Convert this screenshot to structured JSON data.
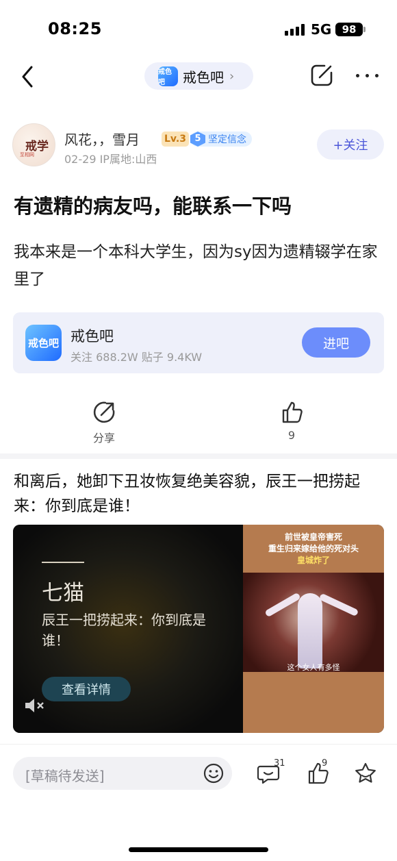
{
  "status_bar": {
    "time": "08:25",
    "network": "5G",
    "battery": "98"
  },
  "nav": {
    "forum_name": "戒色吧",
    "forum_logo_text": "戒色吧"
  },
  "author": {
    "avatar_text": "戒学",
    "avatar_sub": "至相网",
    "name": "风花，，雪月",
    "level": "Lv.3",
    "badge_num": "5",
    "badge_label": "坚定信念",
    "meta": "02-29   IP属地:山西",
    "follow_label": "+关注"
  },
  "post": {
    "title": "有遗精的病友吗，能联系一下吗",
    "body": "我本来是一个本科大学生，因为sy因为遗精辍学在家里了"
  },
  "forum_card": {
    "logo_text": "戒色吧",
    "name": "戒色吧",
    "stats": "关注 688.2W   贴子 9.4KW",
    "enter_label": "进吧"
  },
  "actions": {
    "share_label": "分享",
    "like_count": "9"
  },
  "ad": {
    "title": "和离后，她卸下丑妆恢复绝美容貌，辰王一把捞起来：你到底是谁！",
    "brand": "七猫",
    "desc": "辰王一把捞起来：你到底是谁！",
    "detail_label": "查看详情",
    "right_caption_1": "前世被皇帝害死",
    "right_caption_2": "重生归来嫁给他的死对头",
    "right_caption_3": "皇城炸了",
    "right_sub": "这个女人有多怪"
  },
  "bottom_bar": {
    "draft_placeholder": "[草稿待发送]",
    "comment_count": "31",
    "like_count": "9"
  },
  "colors": {
    "accent": "#6c8dfb",
    "pill_bg": "#eef0fb",
    "follow_text": "#4a55d8"
  }
}
